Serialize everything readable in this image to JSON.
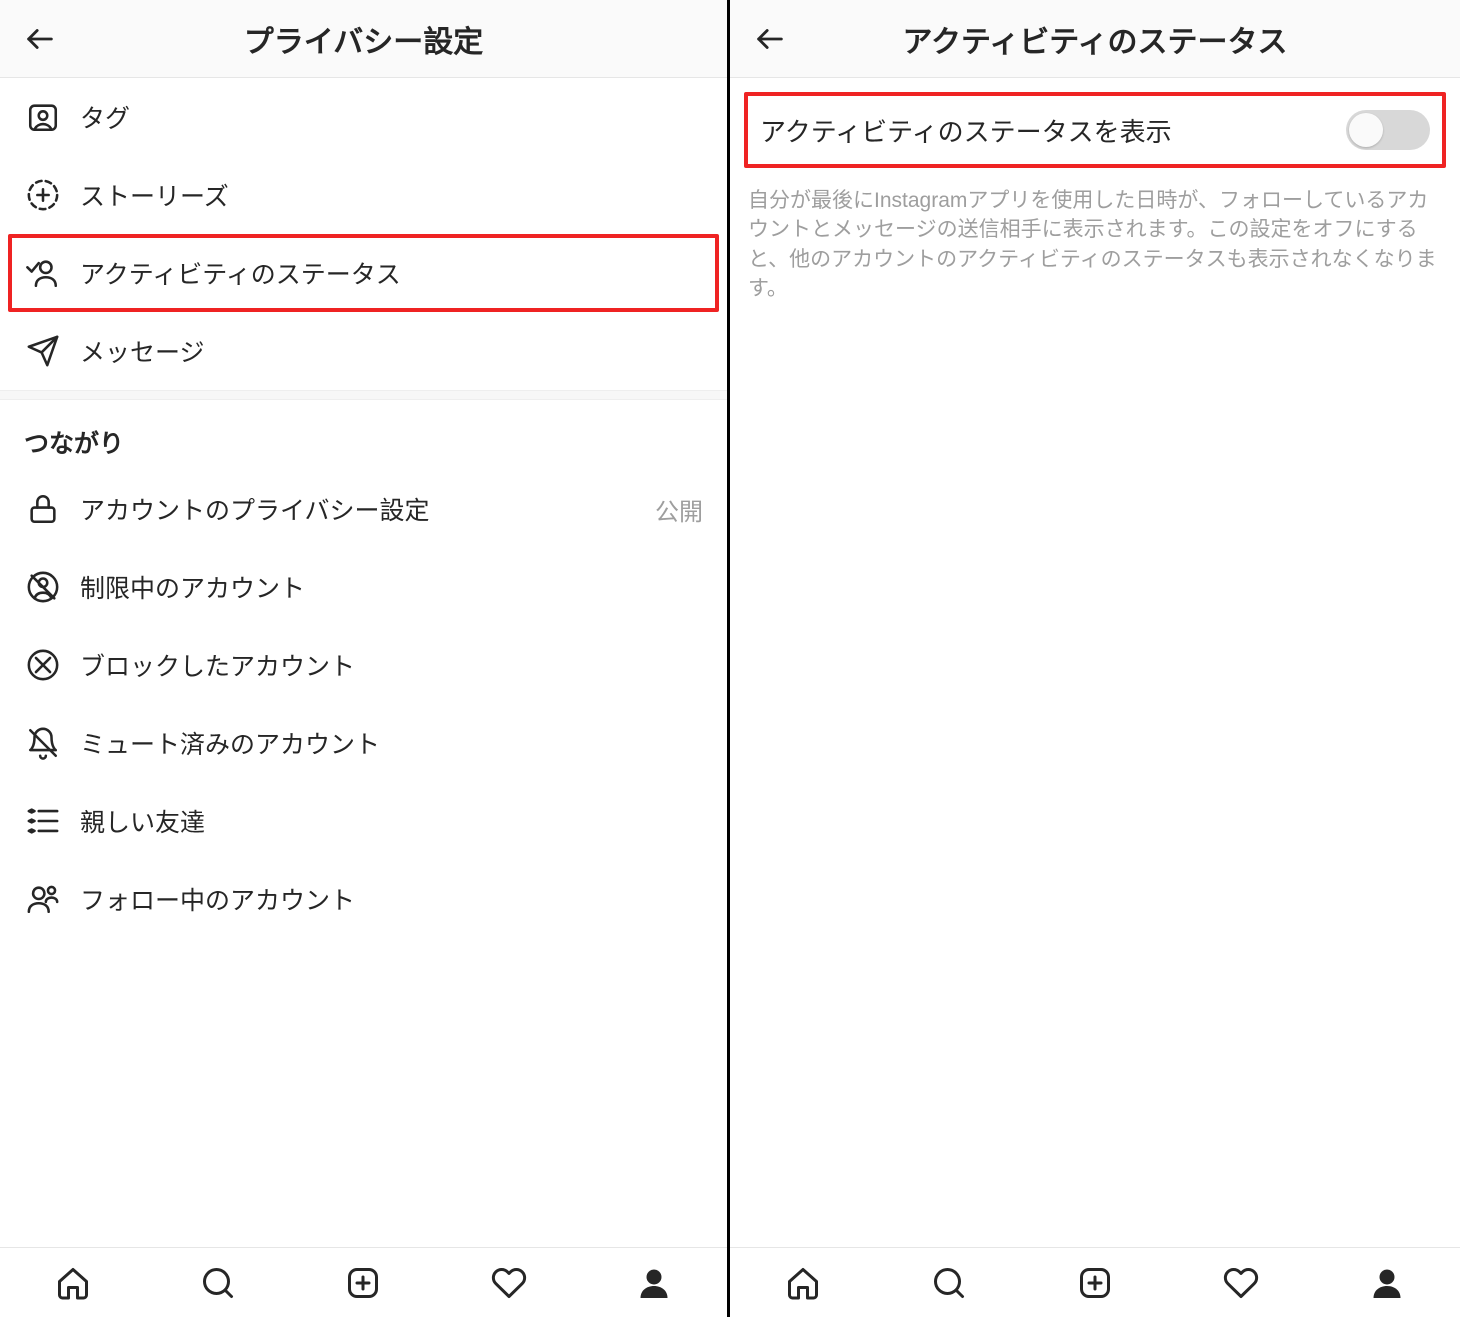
{
  "left": {
    "header_title": "プライバシー設定",
    "section1": {
      "items": [
        {
          "icon": "tag-user-icon",
          "label": "タグ"
        },
        {
          "icon": "story-add-icon",
          "label": "ストーリーズ"
        },
        {
          "icon": "activity-status-icon",
          "label": "アクティビティのステータス",
          "highlight": true
        },
        {
          "icon": "send-icon",
          "label": "メッセージ"
        }
      ]
    },
    "section2_title": "つながり",
    "section2": {
      "items": [
        {
          "icon": "lock-icon",
          "label": "アカウントのプライバシー設定",
          "value": "公開"
        },
        {
          "icon": "restricted-icon",
          "label": "制限中のアカウント"
        },
        {
          "icon": "blocked-icon",
          "label": "ブロックしたアカウント"
        },
        {
          "icon": "muted-icon",
          "label": "ミュート済みのアカウント"
        },
        {
          "icon": "close-friends-icon",
          "label": "親しい友達"
        },
        {
          "icon": "following-icon",
          "label": "フォロー中のアカウント"
        }
      ]
    }
  },
  "right": {
    "header_title": "アクティビティのステータス",
    "toggle_label": "アクティビティのステータスを表示",
    "toggle_on": false,
    "description": "自分が最後にInstagramアプリを使用した日時が、フォローしているアカウントとメッセージの送信相手に表示されます。この設定をオフにすると、他のアカウントのアクティビティのステータスも表示されなくなります。"
  },
  "nav_icons": [
    "home",
    "search",
    "create",
    "heart",
    "profile"
  ]
}
